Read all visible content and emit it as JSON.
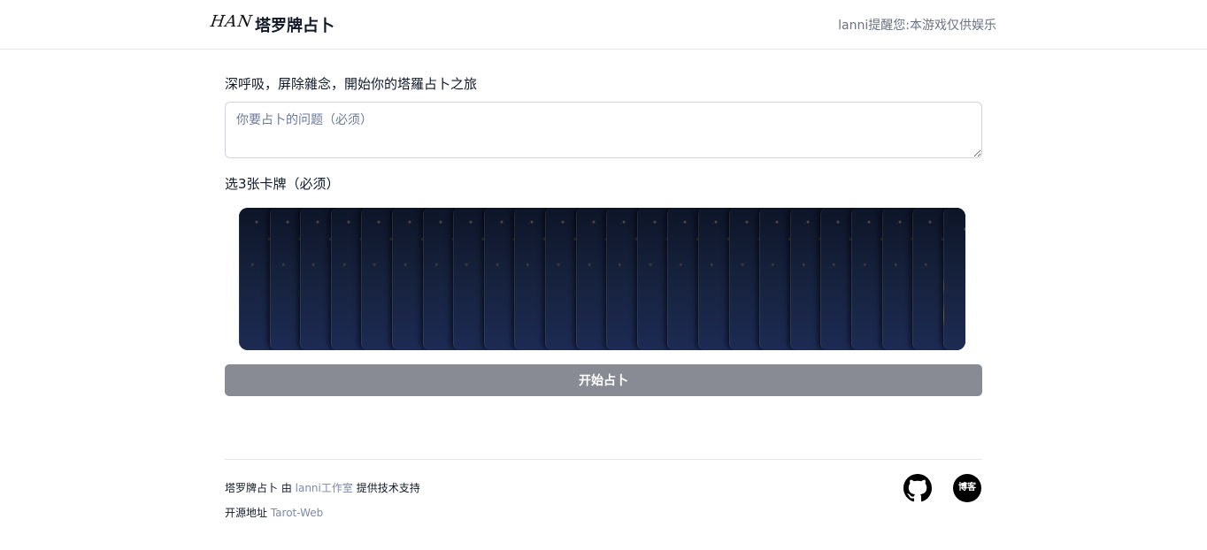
{
  "header": {
    "logo_text": "HAN",
    "title": "塔罗牌占卜",
    "note": "lanni提醒您:本游戏仅供娱乐"
  },
  "main": {
    "intro": "深呼吸，屏除雜念，開始你的塔羅占卜之旅",
    "question_placeholder": "你要占卜的问题（必须）",
    "question_value": "",
    "choose_label": "选3张卡牌（必须）",
    "deck_card_count": 24,
    "start_button": "开始占卜"
  },
  "footer": {
    "line1_prefix": "塔罗牌占卜 由 ",
    "studio_link": "lanni工作室",
    "line1_suffix": " 提供技术支持",
    "line2_prefix": "开源地址 ",
    "repo_link": "Tarot-Web",
    "github_icon": "github-icon",
    "blog_label": "博客"
  },
  "colors": {
    "button_disabled": "#888b93",
    "link": "#7c8aa8",
    "card_back": "#17233f"
  }
}
